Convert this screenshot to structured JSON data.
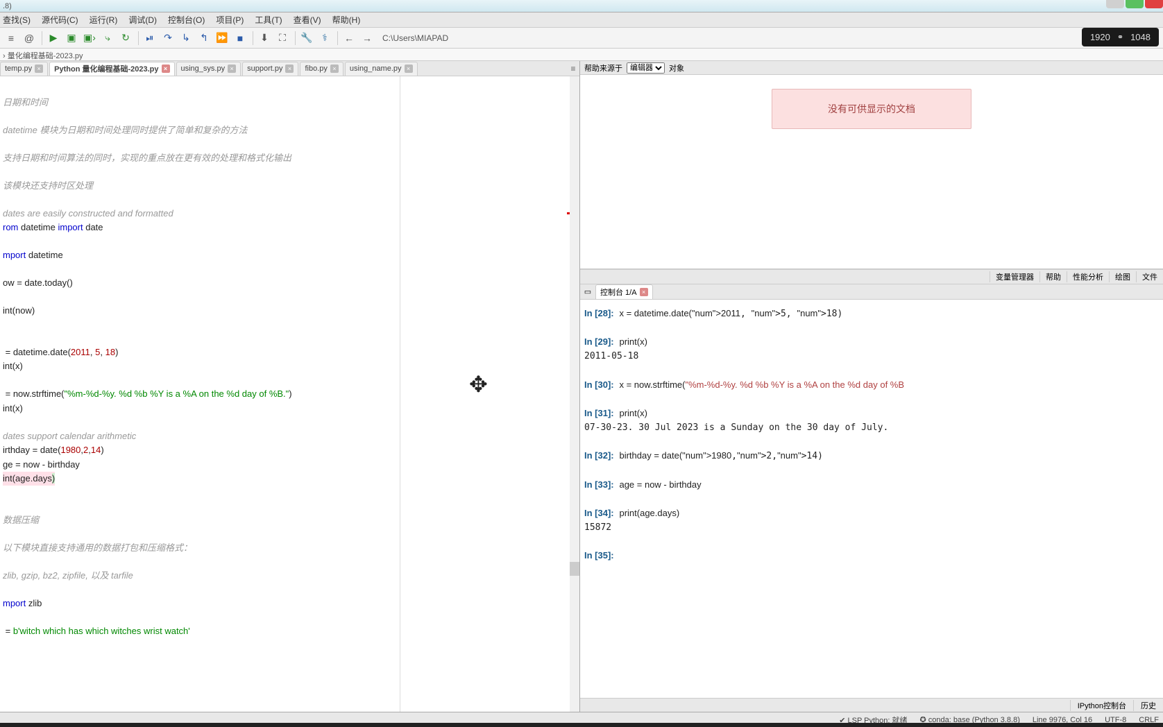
{
  "title_suffix": ".8)",
  "resolution": {
    "w": "1920",
    "h": "1048"
  },
  "menus": [
    "查找(S)",
    "源代码(C)",
    "运行(R)",
    "调试(D)",
    "控制台(O)",
    "项目(P)",
    "工具(T)",
    "查看(V)",
    "帮助(H)"
  ],
  "path": "C:\\Users\\MIAPAD",
  "breadcrumb": "› 量化编程基础-2023.py",
  "tabs": [
    {
      "label": "temp.py",
      "active": false
    },
    {
      "label": "Python 量化编程基础-2023.py",
      "active": true
    },
    {
      "label": "using_sys.py",
      "active": false
    },
    {
      "label": "support.py",
      "active": false
    },
    {
      "label": "fibo.py",
      "active": false
    },
    {
      "label": "using_name.py",
      "active": false
    }
  ],
  "help_src_label": "帮助来源于",
  "help_src_sel": "编辑器",
  "help_obj": "对象",
  "nodoc": "没有可供显示的文档",
  "mid_tabs": [
    "变量管理器",
    "帮助",
    "性能分析",
    "绘图",
    "文件"
  ],
  "console_tab": "控制台 1/A",
  "bottom_tabs": [
    "IPython控制台",
    "历史"
  ],
  "status": {
    "lsp": "✔ LSP Python: 就绪",
    "conda": "✪ conda: base (Python 3.8.8)",
    "line": "Line 9976, Col 16",
    "enc": "UTF-8",
    "eol": "CRLF"
  },
  "console_lines": [
    {
      "n": "28",
      "code": "x = datetime.date(2011, 5, 18)",
      "out": ""
    },
    {
      "n": "29",
      "code": "print(x)",
      "out": "2011-05-18"
    },
    {
      "n": "30",
      "code": "x = now.strftime(\"%m-%d-%y. %d %b %Y is a %A on the %d day of %B",
      "out": ""
    },
    {
      "n": "31",
      "code": "print(x)",
      "out": "07-30-23. 30 Jul 2023 is a Sunday on the 30 day of July."
    },
    {
      "n": "32",
      "code": "birthday = date(1980,2,14)",
      "out": ""
    },
    {
      "n": "33",
      "code": "age = now - birthday",
      "out": ""
    },
    {
      "n": "34",
      "code": "print(age.days)",
      "out": "15872"
    },
    {
      "n": "35",
      "code": "",
      "out": ""
    }
  ],
  "code_text": {
    "c1": "日期和时间",
    "c2": "datetime 模块为日期和时间处理同时提供了简单和复杂的方法",
    "c3": "支持日期和时间算法的同时，实现的重点放在更有效的处理和格式化输出",
    "c4": "该模块还支持时区处理",
    "c5": "dates are easily constructed and formatted",
    "l1a": "rom ",
    "l1b": "datetime ",
    "l1c": "import ",
    "l1d": "date",
    "l2a": "mport ",
    "l2b": "datetime",
    "l3": "ow = date.today()",
    "l4": "int(now)",
    "l5a": " = datetime.date(",
    "l5b": "2011",
    "l5c": ", ",
    "l5d": "5",
    "l5e": ", ",
    "l5f": "18",
    "l5g": ")",
    "l6": "int(x)",
    "l7a": " = now.strftime(",
    "l7b": "\"%m-%d-%y. %d %b %Y is a %A on the %d day of %B.\"",
    "l7c": ")",
    "l8": "int(x)",
    "c6": "dates support calendar arithmetic",
    "l9a": "irthday = date(",
    "l9b": "1980",
    "l9c": ",",
    "l9d": "2",
    "l9e": ",",
    "l9f": "14",
    "l9g": ")",
    "l10": "ge = now - birthday",
    "l11a": "int(age.days",
    "l11b": ")",
    "c7": "数据压缩",
    "c8": "以下模块直接支持通用的数据打包和压缩格式：",
    "c9": "zlib, gzip, bz2, zipfile, 以及 tarfile",
    "l12a": "mport ",
    "l12b": "zlib",
    "l13a": " = ",
    "l13b": "b'witch which has which witches wrist watch'"
  }
}
